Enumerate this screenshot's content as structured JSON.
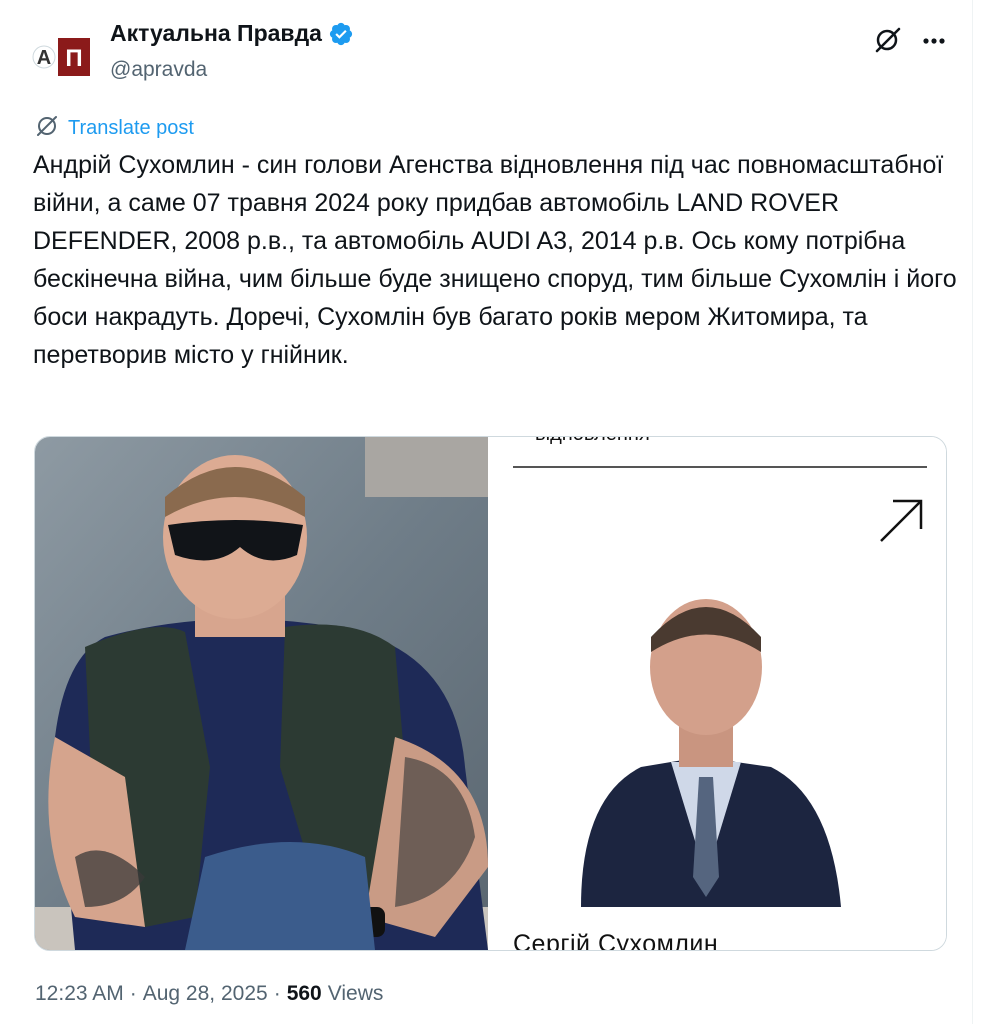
{
  "author": {
    "display_name": "Актуальна Правда",
    "handle": "@apravda",
    "avatar_letters": "АП"
  },
  "colors": {
    "verified_blue": "#1d9bf0",
    "avatar_red": "#8b1a1a",
    "text_primary": "#0f1419",
    "text_secondary": "#536471"
  },
  "icons": {
    "grok": "grok-icon",
    "more": "more-options-icon",
    "translate": "translate-icon",
    "verified": "verified-badge-icon",
    "open": "arrow-up-right-icon"
  },
  "translate": {
    "label": "Translate post"
  },
  "post": {
    "text": "Андрій Сухомлин - син голови Агенства відновлення під час повномасштабної війни, а саме 07 травня 2024 року придбав автомобіль LAND ROVER DEFENDER, 2008 р.в., та автомобіль AUDI A3, 2014 р.в. Ось кому потрібна бескінечна війна, чим більше буде знищено споруд, тим більше Сухомлін і його боси накрадуть. Доречі, Сухомлін був багато років мером Житомира, та перетворив місто у гнійник."
  },
  "media": {
    "right_top_text": "відновлення",
    "right_bottom_text": "Сергій Сухомлин"
  },
  "meta": {
    "time": "12:23 AM",
    "separator": "·",
    "date": "Aug 28, 2025",
    "views_count": "560",
    "views_label": "Views"
  }
}
